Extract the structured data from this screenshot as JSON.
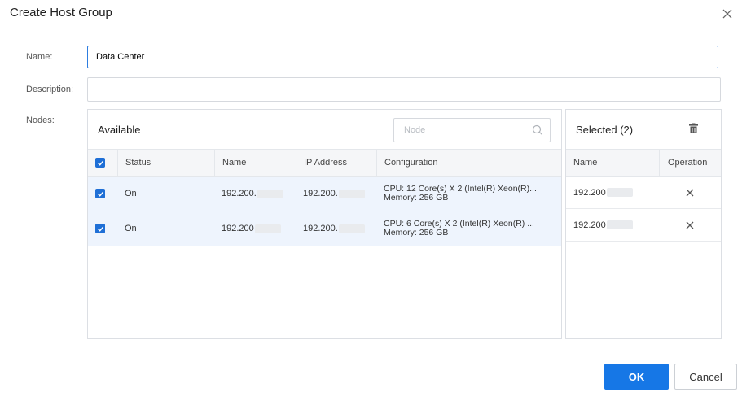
{
  "dialog": {
    "title": "Create Host Group"
  },
  "form": {
    "name_label": "Name:",
    "name_value": "Data Center",
    "description_label": "Description:",
    "description_value": "",
    "nodes_label": "Nodes:"
  },
  "available": {
    "title": "Available",
    "search_placeholder": "Node",
    "columns": {
      "status": "Status",
      "name": "Name",
      "ip": "IP Address",
      "configuration": "Configuration"
    },
    "rows": [
      {
        "checked": true,
        "status": "On",
        "name": "192.200.",
        "ip": "192.200.",
        "config_cpu": "CPU: 12 Core(s) X 2 (Intel(R) Xeon(R)...",
        "config_mem": "Memory: 256 GB"
      },
      {
        "checked": true,
        "status": "On",
        "name": "192.200",
        "ip": "192.200.",
        "config_cpu": "CPU: 6 Core(s) X 2 (Intel(R) Xeon(R) ...",
        "config_mem": "Memory: 256 GB"
      }
    ]
  },
  "selected": {
    "title": "Selected (2)",
    "columns": {
      "name": "Name",
      "operation": "Operation"
    },
    "rows": [
      {
        "name": "192.200"
      },
      {
        "name": "192.200"
      }
    ]
  },
  "footer": {
    "ok_label": "OK",
    "cancel_label": "Cancel"
  },
  "colors": {
    "accent": "#1677e6",
    "checkbox": "#1f6fd6",
    "row_highlight": "#eef4fd"
  }
}
